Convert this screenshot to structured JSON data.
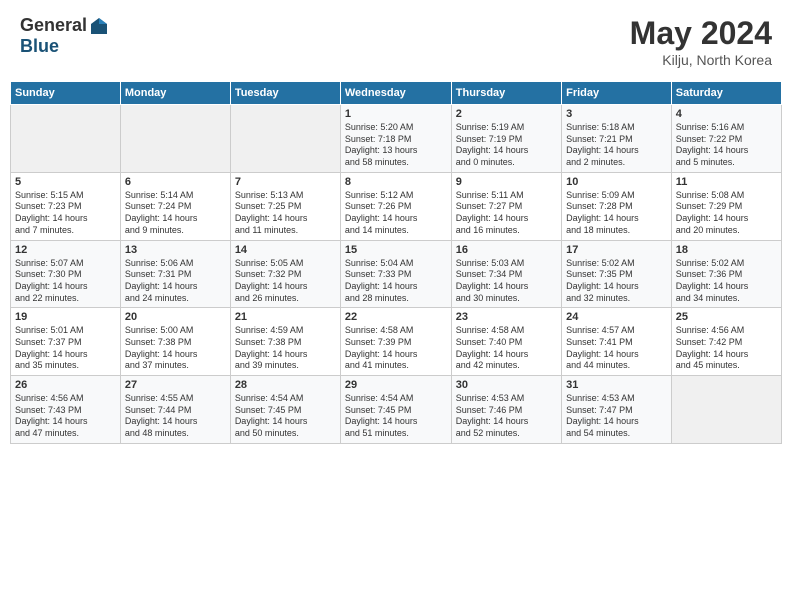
{
  "header": {
    "logo_general": "General",
    "logo_blue": "Blue",
    "title": "May 2024",
    "location": "Kilju, North Korea"
  },
  "days_of_week": [
    "Sunday",
    "Monday",
    "Tuesday",
    "Wednesday",
    "Thursday",
    "Friday",
    "Saturday"
  ],
  "weeks": [
    [
      {
        "day": "",
        "content": ""
      },
      {
        "day": "",
        "content": ""
      },
      {
        "day": "",
        "content": ""
      },
      {
        "day": "1",
        "content": "Sunrise: 5:20 AM\nSunset: 7:18 PM\nDaylight: 13 hours\nand 58 minutes."
      },
      {
        "day": "2",
        "content": "Sunrise: 5:19 AM\nSunset: 7:19 PM\nDaylight: 14 hours\nand 0 minutes."
      },
      {
        "day": "3",
        "content": "Sunrise: 5:18 AM\nSunset: 7:21 PM\nDaylight: 14 hours\nand 2 minutes."
      },
      {
        "day": "4",
        "content": "Sunrise: 5:16 AM\nSunset: 7:22 PM\nDaylight: 14 hours\nand 5 minutes."
      }
    ],
    [
      {
        "day": "5",
        "content": "Sunrise: 5:15 AM\nSunset: 7:23 PM\nDaylight: 14 hours\nand 7 minutes."
      },
      {
        "day": "6",
        "content": "Sunrise: 5:14 AM\nSunset: 7:24 PM\nDaylight: 14 hours\nand 9 minutes."
      },
      {
        "day": "7",
        "content": "Sunrise: 5:13 AM\nSunset: 7:25 PM\nDaylight: 14 hours\nand 11 minutes."
      },
      {
        "day": "8",
        "content": "Sunrise: 5:12 AM\nSunset: 7:26 PM\nDaylight: 14 hours\nand 14 minutes."
      },
      {
        "day": "9",
        "content": "Sunrise: 5:11 AM\nSunset: 7:27 PM\nDaylight: 14 hours\nand 16 minutes."
      },
      {
        "day": "10",
        "content": "Sunrise: 5:09 AM\nSunset: 7:28 PM\nDaylight: 14 hours\nand 18 minutes."
      },
      {
        "day": "11",
        "content": "Sunrise: 5:08 AM\nSunset: 7:29 PM\nDaylight: 14 hours\nand 20 minutes."
      }
    ],
    [
      {
        "day": "12",
        "content": "Sunrise: 5:07 AM\nSunset: 7:30 PM\nDaylight: 14 hours\nand 22 minutes."
      },
      {
        "day": "13",
        "content": "Sunrise: 5:06 AM\nSunset: 7:31 PM\nDaylight: 14 hours\nand 24 minutes."
      },
      {
        "day": "14",
        "content": "Sunrise: 5:05 AM\nSunset: 7:32 PM\nDaylight: 14 hours\nand 26 minutes."
      },
      {
        "day": "15",
        "content": "Sunrise: 5:04 AM\nSunset: 7:33 PM\nDaylight: 14 hours\nand 28 minutes."
      },
      {
        "day": "16",
        "content": "Sunrise: 5:03 AM\nSunset: 7:34 PM\nDaylight: 14 hours\nand 30 minutes."
      },
      {
        "day": "17",
        "content": "Sunrise: 5:02 AM\nSunset: 7:35 PM\nDaylight: 14 hours\nand 32 minutes."
      },
      {
        "day": "18",
        "content": "Sunrise: 5:02 AM\nSunset: 7:36 PM\nDaylight: 14 hours\nand 34 minutes."
      }
    ],
    [
      {
        "day": "19",
        "content": "Sunrise: 5:01 AM\nSunset: 7:37 PM\nDaylight: 14 hours\nand 35 minutes."
      },
      {
        "day": "20",
        "content": "Sunrise: 5:00 AM\nSunset: 7:38 PM\nDaylight: 14 hours\nand 37 minutes."
      },
      {
        "day": "21",
        "content": "Sunrise: 4:59 AM\nSunset: 7:38 PM\nDaylight: 14 hours\nand 39 minutes."
      },
      {
        "day": "22",
        "content": "Sunrise: 4:58 AM\nSunset: 7:39 PM\nDaylight: 14 hours\nand 41 minutes."
      },
      {
        "day": "23",
        "content": "Sunrise: 4:58 AM\nSunset: 7:40 PM\nDaylight: 14 hours\nand 42 minutes."
      },
      {
        "day": "24",
        "content": "Sunrise: 4:57 AM\nSunset: 7:41 PM\nDaylight: 14 hours\nand 44 minutes."
      },
      {
        "day": "25",
        "content": "Sunrise: 4:56 AM\nSunset: 7:42 PM\nDaylight: 14 hours\nand 45 minutes."
      }
    ],
    [
      {
        "day": "26",
        "content": "Sunrise: 4:56 AM\nSunset: 7:43 PM\nDaylight: 14 hours\nand 47 minutes."
      },
      {
        "day": "27",
        "content": "Sunrise: 4:55 AM\nSunset: 7:44 PM\nDaylight: 14 hours\nand 48 minutes."
      },
      {
        "day": "28",
        "content": "Sunrise: 4:54 AM\nSunset: 7:45 PM\nDaylight: 14 hours\nand 50 minutes."
      },
      {
        "day": "29",
        "content": "Sunrise: 4:54 AM\nSunset: 7:45 PM\nDaylight: 14 hours\nand 51 minutes."
      },
      {
        "day": "30",
        "content": "Sunrise: 4:53 AM\nSunset: 7:46 PM\nDaylight: 14 hours\nand 52 minutes."
      },
      {
        "day": "31",
        "content": "Sunrise: 4:53 AM\nSunset: 7:47 PM\nDaylight: 14 hours\nand 54 minutes."
      },
      {
        "day": "",
        "content": ""
      }
    ]
  ]
}
